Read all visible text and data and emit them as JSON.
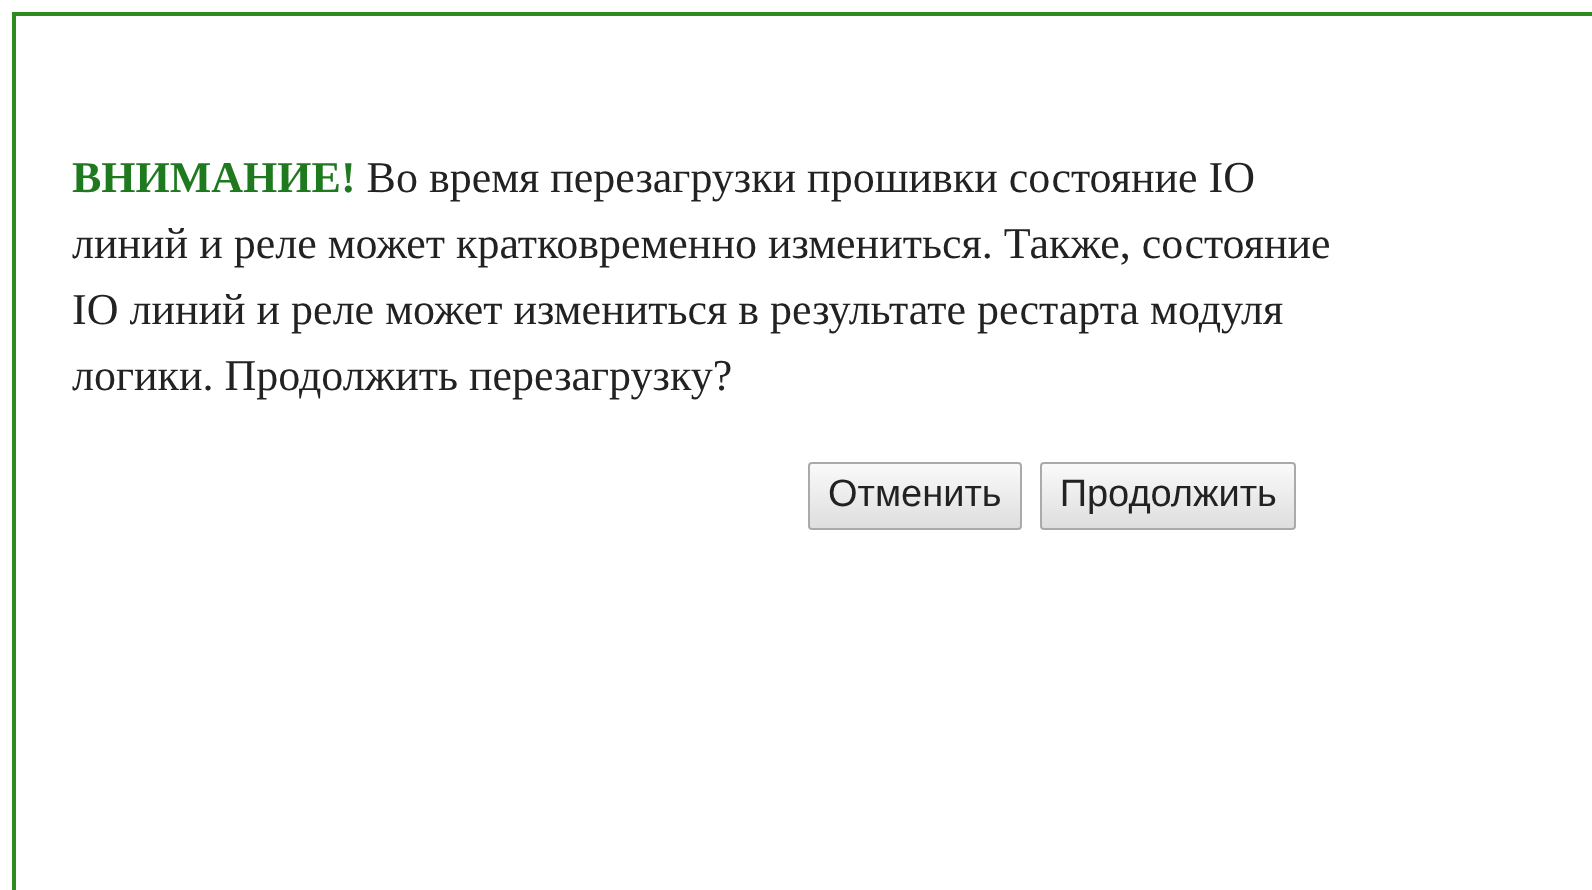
{
  "dialog": {
    "warning_label": "ВНИМАНИЕ!",
    "message": "Во время перезагрузки прошивки состояние IO линий и реле может кратковременно измениться. Также, состояние IO линий и реле может измениться в результате рестарта модуля логики. Продолжить перезагрузку?",
    "buttons": [
      "Отменить",
      "Продолжить"
    ]
  }
}
